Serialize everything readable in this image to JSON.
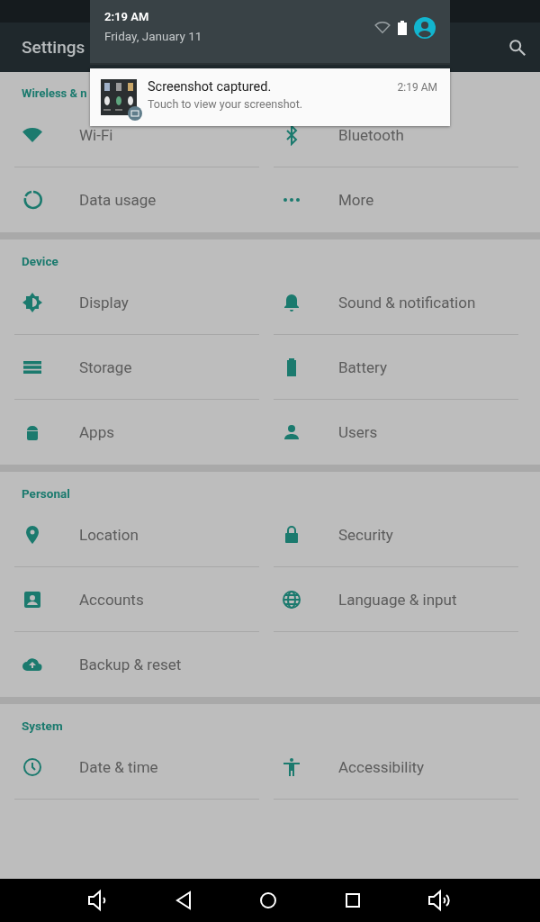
{
  "app_bar": {
    "title": "Settings"
  },
  "sections": [
    {
      "title": "Wireless & n",
      "items": [
        {
          "label": "Wi-Fi"
        },
        {
          "label": "Bluetooth"
        },
        {
          "label": "Data usage"
        },
        {
          "label": "More"
        }
      ]
    },
    {
      "title": "Device",
      "items": [
        {
          "label": "Display"
        },
        {
          "label": "Sound & notification"
        },
        {
          "label": "Storage"
        },
        {
          "label": "Battery"
        },
        {
          "label": "Apps"
        },
        {
          "label": "Users"
        }
      ]
    },
    {
      "title": "Personal",
      "items": [
        {
          "label": "Location"
        },
        {
          "label": "Security"
        },
        {
          "label": "Accounts"
        },
        {
          "label": "Language & input"
        },
        {
          "label": "Backup & reset"
        }
      ]
    },
    {
      "title": "System",
      "items": [
        {
          "label": "Date & time"
        },
        {
          "label": "Accessibility"
        }
      ]
    }
  ],
  "shade": {
    "time": "2:19 AM",
    "date": "Friday, January 11"
  },
  "notification": {
    "title": "Screenshot captured.",
    "text": "Touch to view your screenshot.",
    "time": "2:19 AM"
  }
}
